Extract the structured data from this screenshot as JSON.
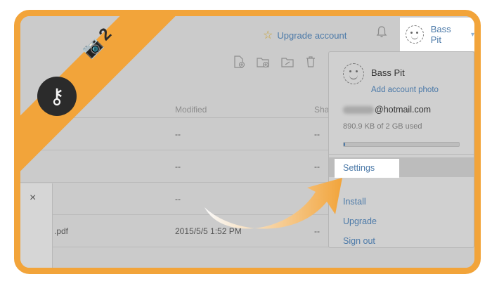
{
  "header": {
    "upgrade_label": "Upgrade account",
    "user_name": "Bass Pit"
  },
  "table": {
    "columns": [
      "Modified",
      "Sha"
    ],
    "rows": [
      {
        "name": "",
        "modified": "--",
        "shared": "--"
      },
      {
        "name": "",
        "modified": "--",
        "shared": "--"
      },
      {
        "name": "",
        "modified": "--",
        "shared": "--"
      },
      {
        "name": ".pdf",
        "modified": "2015/5/5 1:52 PM",
        "shared": "--"
      }
    ]
  },
  "sidepanel": {
    "close_glyph": "×"
  },
  "dropdown": {
    "name": "Bass Pit",
    "add_photo": "Add account photo",
    "email_domain": "@hotmail.com",
    "usage": "890.9 KB of 2 GB used",
    "usage_fraction": 0.0004,
    "items": [
      "Settings",
      "Install",
      "Upgrade",
      "Sign out"
    ]
  },
  "overlay": {
    "step_number": "2",
    "key_glyph": "⚷",
    "camera_icon": "camera-icon",
    "banner_color": "#f2a43a"
  },
  "colors": {
    "accent": "#4b79a8",
    "frame": "#f2a43a"
  }
}
